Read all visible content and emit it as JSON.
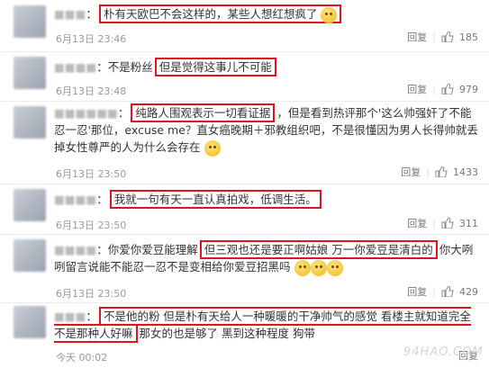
{
  "comments": [
    {
      "prefix": "：",
      "hl": "朴有天欧巴不会这样的，某些人想红想疯了",
      "tail": "",
      "time": "6月13日 23:46",
      "reply": "回复",
      "likes": "185",
      "emoji": 1
    },
    {
      "prefix": "：不是粉丝",
      "hl": "但是觉得这事儿不可能",
      "tail": "",
      "time": "6月13日 23:48",
      "reply": "回复",
      "likes": "979",
      "emoji": 0
    },
    {
      "prefix": "：",
      "hl": "纯路人围观表示一切看证据",
      "tail": "，但是看到热评那个'这么帅强奸了不能忍一忍'那位，excuse me？直女癌晚期＋邪教组织吧，不是很懂因为男人长得帅就丢掉女性尊严的人为什么会存在",
      "time": "6月13日 23:50",
      "reply": "回复",
      "likes": "1433",
      "emoji": 1
    },
    {
      "prefix": "：",
      "hl": "我就一句有天一直认真拍戏，低调生活。",
      "tail": "",
      "time": "6月13日 23:50",
      "reply": "回复",
      "likes": "311",
      "emoji": 0
    },
    {
      "prefix": "：你爱你爱豆能理解",
      "hl": "但三观也还是要正啊姑娘 万一你爱豆是清白的",
      "tail": "你大咧咧留言说能不能忍一忍不是变相给你爱豆招黑吗",
      "time": "6月13日 23:50",
      "reply": "回复",
      "likes": "429",
      "emoji": 3
    },
    {
      "prefix": "：",
      "hl": "不是他的粉 但是朴有天给人一种暖暖的干净帅气的感觉 看楼主就知道完全不是那种人好嘛",
      "tail": "那女的也是够了 黑到这种程度 狗带",
      "time": "今天 00:02",
      "reply": "回复",
      "likes": "",
      "emoji": 0
    }
  ],
  "watermark": "94HAO.COM"
}
